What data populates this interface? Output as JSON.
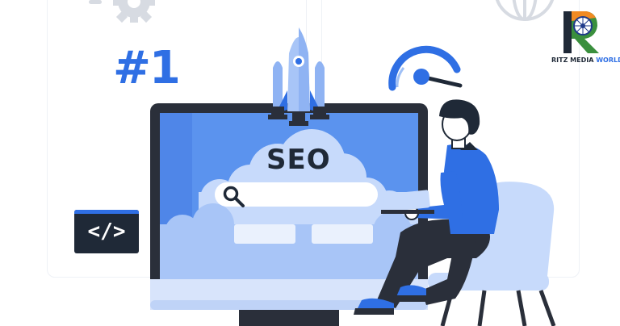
{
  "hero": {
    "rank_text": "#1",
    "code_text": "</>",
    "seo_text": "SEO"
  },
  "logo": {
    "brand_main": "RITZ MEDIA ",
    "brand_accent": "WORLD"
  },
  "icons": [
    "gear-icon",
    "globe-icon",
    "rocket-icon",
    "speedometer-icon",
    "search-icon",
    "code-icon",
    "logo-icon"
  ],
  "colors": {
    "primary_blue": "#2f6fe4",
    "screen_blue": "#5b93ee",
    "light_blue": "#c7dafb",
    "dark": "#1f2937",
    "monitor": "#2a2f3a"
  }
}
